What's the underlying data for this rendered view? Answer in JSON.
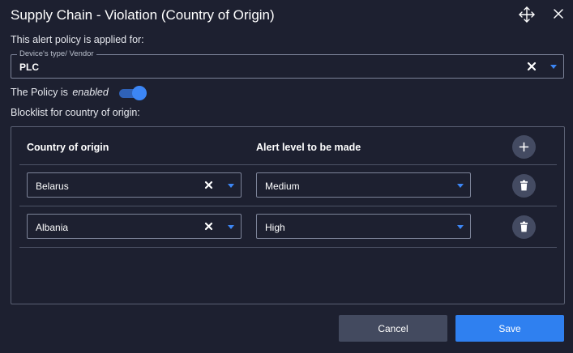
{
  "dialog": {
    "title": "Supply Chain - Violation (Country of Origin)",
    "applied_label": "This alert policy is applied for:",
    "device_field": {
      "legend": "Device's type/ Vendor",
      "value": "PLC"
    },
    "policy": {
      "prefix": "The Policy is",
      "state": "enabled",
      "enabled": true
    },
    "blocklist_label": "Blocklist for country of origin:",
    "table": {
      "columns": [
        "Country of origin",
        "Alert level to be made"
      ],
      "rows": [
        {
          "country": "Belarus",
          "level": "Medium"
        },
        {
          "country": "Albania",
          "level": "High"
        }
      ]
    },
    "buttons": {
      "cancel": "Cancel",
      "save": "Save"
    }
  },
  "icons": {
    "move": "move-icon",
    "close": "close-icon",
    "clear": "clear-x-icon",
    "dropdown": "chevron-down-icon",
    "add": "plus-icon",
    "delete": "trash-icon"
  },
  "colors": {
    "background": "#1d2030",
    "accent": "#2f80f0",
    "toggle_knob": "#3c86f5",
    "round_button": "#444b62",
    "cancel_button": "#434a5f"
  }
}
